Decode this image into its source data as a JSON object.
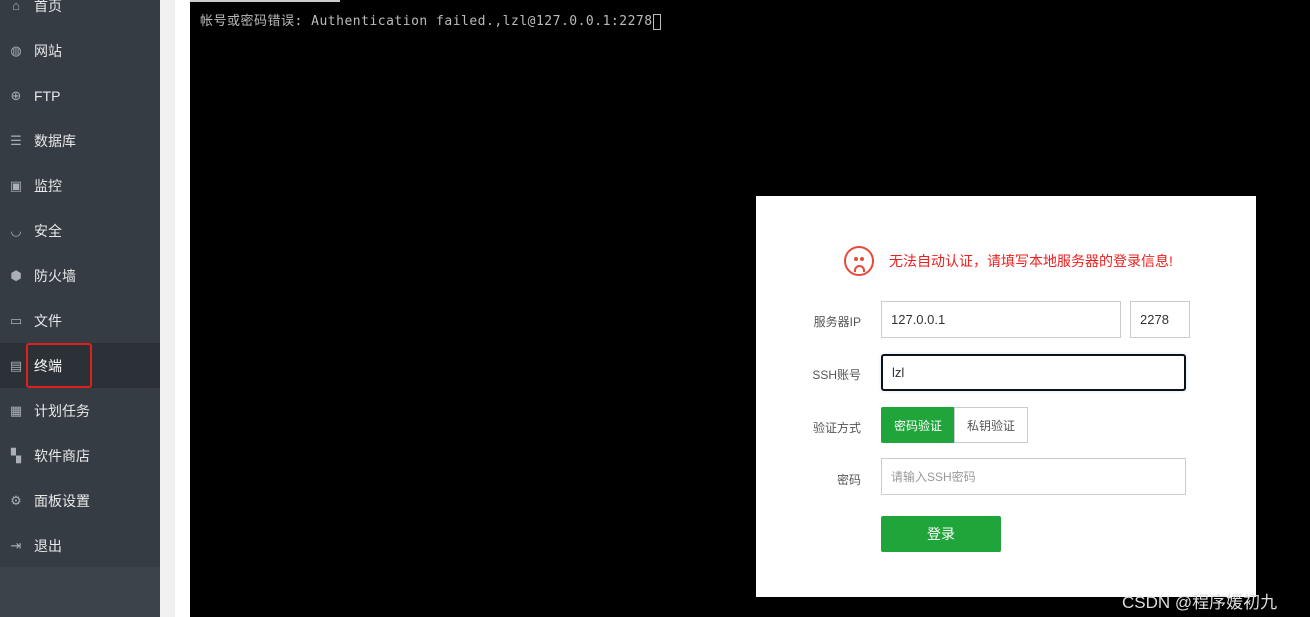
{
  "sidebar": {
    "items": [
      {
        "label": "首页",
        "icon": "home-icon"
      },
      {
        "label": "网站",
        "icon": "globe-icon"
      },
      {
        "label": "FTP",
        "icon": "ftp-icon"
      },
      {
        "label": "数据库",
        "icon": "database-icon"
      },
      {
        "label": "监控",
        "icon": "monitor-icon"
      },
      {
        "label": "安全",
        "icon": "shield-icon"
      },
      {
        "label": "防火墙",
        "icon": "firewall-icon"
      },
      {
        "label": "文件",
        "icon": "folder-icon"
      },
      {
        "label": "终端",
        "icon": "terminal-icon",
        "active": true
      },
      {
        "label": "计划任务",
        "icon": "calendar-icon"
      },
      {
        "label": "软件商店",
        "icon": "apps-icon"
      },
      {
        "label": "面板设置",
        "icon": "gear-icon"
      },
      {
        "label": "退出",
        "icon": "logout-icon"
      }
    ]
  },
  "terminal": {
    "output": "帐号或密码错误: Authentication failed.,lzl@127.0.0.1:2278"
  },
  "dialog": {
    "warning": "无法自动认证，请填写本地服务器的登录信息!",
    "server_ip_label": "服务器IP",
    "server_ip": "127.0.0.1",
    "port": "2278",
    "ssh_user_label": "SSH账号",
    "ssh_user": "lzl",
    "auth_label": "验证方式",
    "auth_password": "密码验证",
    "auth_key": "私钥验证",
    "password_label": "密码",
    "password_placeholder": "请输入SSH密码",
    "login": "登录"
  },
  "watermark": "CSDN @程序媛初九",
  "colors": {
    "accent": "#20a53a",
    "warning": "#f01d1d",
    "highlight": "#e0201c"
  }
}
